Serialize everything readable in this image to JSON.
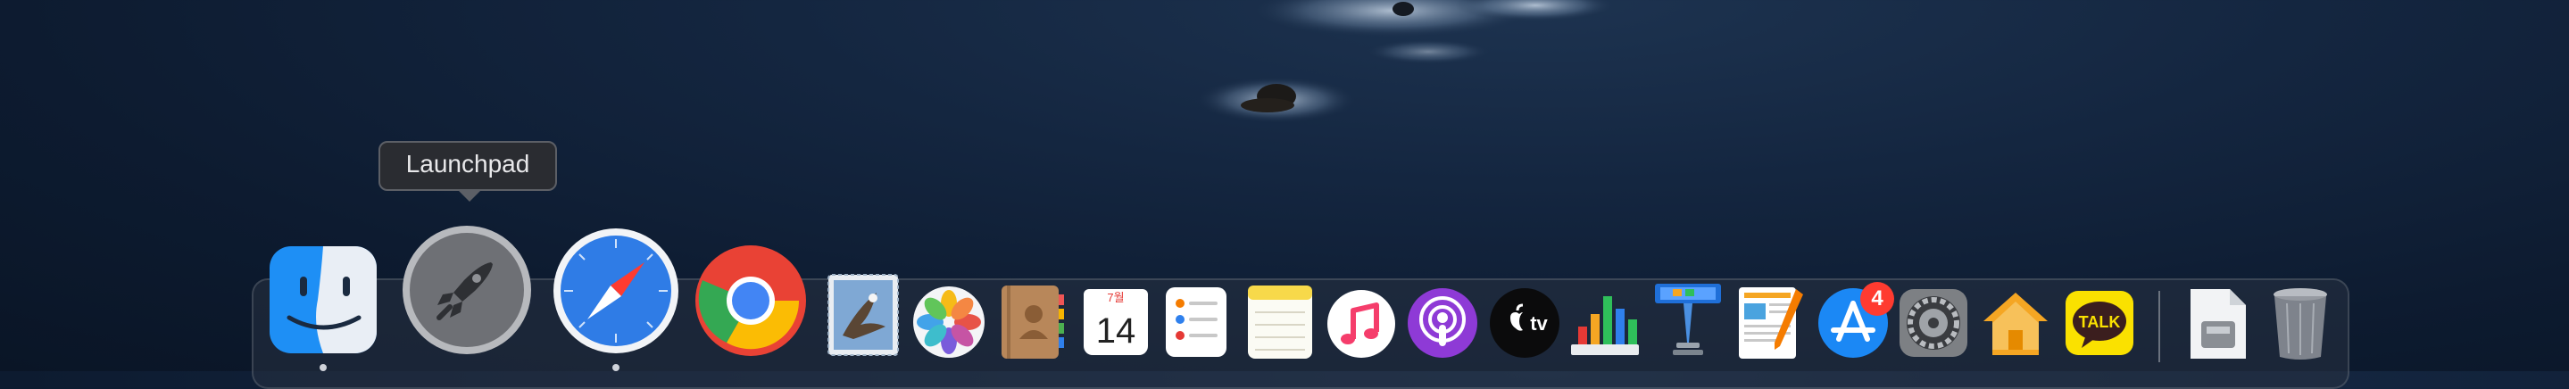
{
  "desktop": {
    "wallpaper": "ocean-rocks-night"
  },
  "tooltip": {
    "text": "Launchpad"
  },
  "dock": {
    "apps": [
      {
        "name": "Finder",
        "icon": "finder-icon",
        "running": true
      },
      {
        "name": "Launchpad",
        "icon": "launchpad-rocket-icon",
        "running": false
      },
      {
        "name": "Safari",
        "icon": "safari-compass-icon",
        "running": true
      },
      {
        "name": "Google Chrome",
        "icon": "chrome-icon",
        "running": false
      },
      {
        "name": "Mail",
        "icon": "mail-stamp-icon",
        "running": false
      },
      {
        "name": "Photos",
        "icon": "photos-flower-icon",
        "running": false
      },
      {
        "name": "Contacts",
        "icon": "contacts-book-icon",
        "running": false
      },
      {
        "name": "Calendar",
        "icon": "calendar-icon",
        "running": false
      },
      {
        "name": "Reminders",
        "icon": "reminders-icon",
        "running": false
      },
      {
        "name": "Notes",
        "icon": "notes-icon",
        "running": false
      },
      {
        "name": "Music",
        "icon": "music-note-icon",
        "running": false
      },
      {
        "name": "Podcasts",
        "icon": "podcasts-icon",
        "running": false
      },
      {
        "name": "TV",
        "icon": "apple-tv-icon",
        "running": false
      },
      {
        "name": "Numbers",
        "icon": "numbers-chart-icon",
        "running": false
      },
      {
        "name": "Keynote",
        "icon": "keynote-podium-icon",
        "running": false
      },
      {
        "name": "Pages",
        "icon": "pages-pen-icon",
        "running": false
      },
      {
        "name": "App Store",
        "icon": "app-store-icon",
        "running": false
      },
      {
        "name": "System Preferences",
        "icon": "gear-icon",
        "running": false
      },
      {
        "name": "Home",
        "icon": "home-icon",
        "running": false
      },
      {
        "name": "KakaoTalk",
        "icon": "kakaotalk-icon",
        "running": false
      },
      {
        "name": "Downloads",
        "icon": "archive-file-icon",
        "running": false
      },
      {
        "name": "Trash",
        "icon": "trash-icon",
        "running": false
      }
    ],
    "calendar": {
      "month": "7월",
      "day": "14"
    },
    "tv_label": "tv",
    "kakao_label": "TALK",
    "app_store_badge": "4"
  },
  "colors": {
    "finder_blue": "#1e8ff5",
    "safari_blue": "#2f7ce6",
    "podcasts_purple": "#8e3ad6",
    "notes_yellow": "#f7d94a",
    "kakao_yellow": "#fae100",
    "badge_red": "#ff3b30"
  }
}
